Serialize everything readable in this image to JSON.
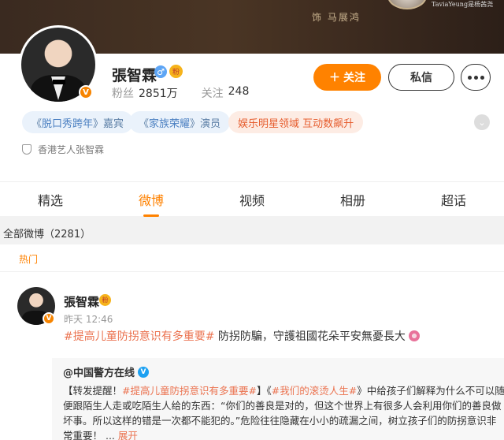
{
  "banner": {
    "credit": "饰 马展鸿",
    "signature": "TaviaYeung是杨茜尧"
  },
  "profile": {
    "name": "張智霖",
    "gender_icon": "♂",
    "fan_badge": "粉",
    "avatar_badge": "V",
    "fans_label": "粉丝",
    "fans_value": "2851万",
    "follow_label": "关注",
    "follow_value": "248",
    "follow_button": "关注",
    "message_button": "私信",
    "tags": [
      {
        "prefix": "《",
        "title": "脱口秀跨年",
        "suffix": "》嘉宾"
      },
      {
        "prefix": "《",
        "title": "家族荣耀",
        "suffix": "》演员"
      },
      {
        "text": "娱乐明星领域 互动数飙升"
      }
    ],
    "verification": "香港艺人张智霖"
  },
  "tabs": [
    "精选",
    "微博",
    "视频",
    "相册",
    "超话"
  ],
  "active_tab": "微博",
  "section_title": "全部微博（2281）",
  "feed": {
    "hot_label": "热门",
    "post": {
      "author": "張智霖",
      "time": "昨天 12:46",
      "hashtag": "#提高儿童防拐意识有多重要#",
      "text": " 防拐防騙，守護祖國花朵平安無憂長大"
    },
    "repost": {
      "author": "@中国警方在线",
      "verified": "V",
      "lines": [
        {
          "a": "【转发提醒！",
          "h1": "#提高儿童防拐意识有多重要#",
          "b": "】《",
          "h2": "#我们的滚烫人生#",
          "c": "》中给孩子们解释为什么不可以随"
        },
        {
          "a": "便跟陌生人走或吃陌生人给的东西：“你们的善良是对的，但这个世界上有很多人会利用你们的善良做"
        },
        {
          "a": "坏事。所以这样的错是一次都不能犯的。”危险往往隐藏在小小的疏漏之间，树立孩子们的防拐意识非"
        },
        {
          "a": "常重要！  ... ",
          "more": "展开"
        }
      ]
    }
  },
  "colors": {
    "accent": "#ff8200",
    "hashtag": "#eb7350",
    "tag_bg": "#eaf2fb"
  }
}
